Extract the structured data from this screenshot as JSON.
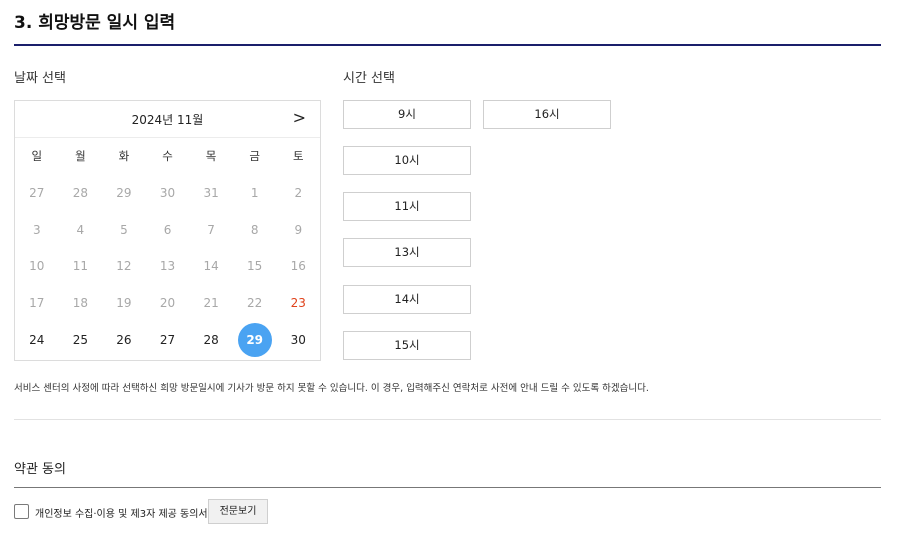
{
  "section": {
    "title": "3. 희망방문 일시 입력"
  },
  "date_label": "날짜 선택",
  "time_label": "시간 선택",
  "calendar": {
    "month_label": "2024년 11월",
    "next_glyph": ">",
    "weekdays": [
      "일",
      "월",
      "화",
      "수",
      "목",
      "금",
      "토"
    ],
    "days": [
      {
        "label": "27",
        "state": "muted"
      },
      {
        "label": "28",
        "state": "muted"
      },
      {
        "label": "29",
        "state": "muted"
      },
      {
        "label": "30",
        "state": "muted"
      },
      {
        "label": "31",
        "state": "muted"
      },
      {
        "label": "1",
        "state": "muted"
      },
      {
        "label": "2",
        "state": "muted"
      },
      {
        "label": "3",
        "state": "muted"
      },
      {
        "label": "4",
        "state": "muted"
      },
      {
        "label": "5",
        "state": "muted"
      },
      {
        "label": "6",
        "state": "muted"
      },
      {
        "label": "7",
        "state": "muted"
      },
      {
        "label": "8",
        "state": "muted"
      },
      {
        "label": "9",
        "state": "muted"
      },
      {
        "label": "10",
        "state": "muted"
      },
      {
        "label": "11",
        "state": "muted"
      },
      {
        "label": "12",
        "state": "muted"
      },
      {
        "label": "13",
        "state": "muted"
      },
      {
        "label": "14",
        "state": "muted"
      },
      {
        "label": "15",
        "state": "muted"
      },
      {
        "label": "16",
        "state": "muted"
      },
      {
        "label": "17",
        "state": "muted"
      },
      {
        "label": "18",
        "state": "muted"
      },
      {
        "label": "19",
        "state": "muted"
      },
      {
        "label": "20",
        "state": "muted"
      },
      {
        "label": "21",
        "state": "muted"
      },
      {
        "label": "22",
        "state": "muted"
      },
      {
        "label": "23",
        "state": "holiday"
      },
      {
        "label": "24",
        "state": "avail"
      },
      {
        "label": "25",
        "state": "avail"
      },
      {
        "label": "26",
        "state": "avail"
      },
      {
        "label": "27",
        "state": "avail"
      },
      {
        "label": "28",
        "state": "avail"
      },
      {
        "label": "29",
        "state": "selected"
      },
      {
        "label": "30",
        "state": "avail"
      }
    ]
  },
  "time_slots": [
    "9시",
    "16시",
    "10시",
    "11시",
    "13시",
    "14시",
    "15시"
  ],
  "notice": "서비스 센터의 사정에 따라 선택하신 희망 방문일시에 기사가 방문 하지 못할 수 있습니다. 이 경우, 입력해주신 연락처로 사전에 안내 드릴 수 있도록 하겠습니다.",
  "terms": {
    "title": "약관 동의",
    "consent_label": "개인정보 수집·이용 및 제3자 제공 동의서",
    "view_button": "전문보기",
    "checked": false
  },
  "colors": {
    "accent_rule": "#1a1f6b",
    "selected_day": "#4aa3f2",
    "holiday": "#e0421b"
  }
}
